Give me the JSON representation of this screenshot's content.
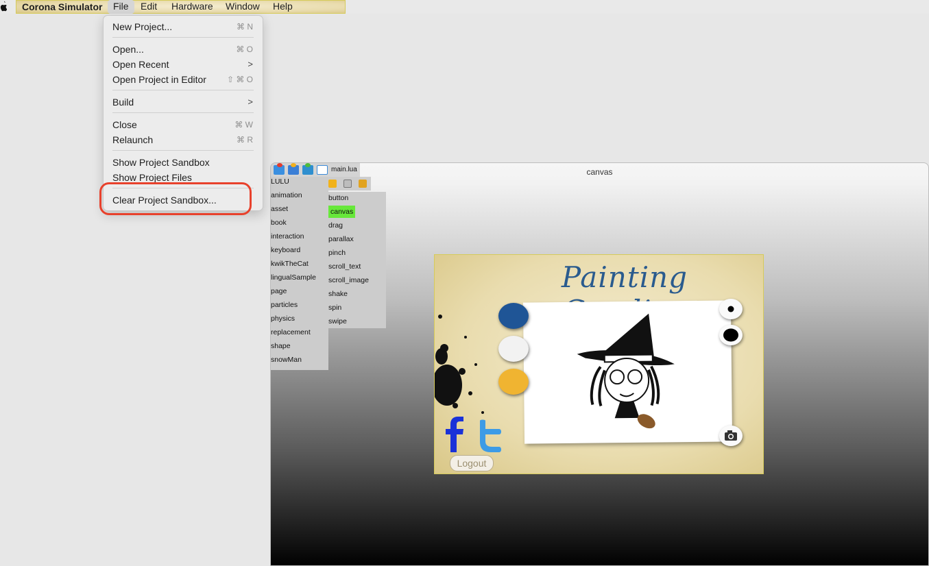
{
  "menubar": {
    "app_name": "Corona Simulator",
    "items": [
      "File",
      "Edit",
      "Hardware",
      "Window",
      "Help"
    ]
  },
  "file_menu": {
    "new_project": {
      "label": "New Project...",
      "shortcut": "⌘ N"
    },
    "open": {
      "label": "Open...",
      "shortcut": "⌘ O"
    },
    "open_recent": {
      "label": "Open Recent"
    },
    "open_in_editor": {
      "label": "Open Project in Editor",
      "shortcut": "⇧ ⌘ O"
    },
    "build": {
      "label": "Build"
    },
    "close": {
      "label": "Close",
      "shortcut": "⌘ W"
    },
    "relaunch": {
      "label": "Relaunch",
      "shortcut": "⌘ R"
    },
    "show_sandbox": {
      "label": "Show Project Sandbox"
    },
    "show_files": {
      "label": "Show Project Files"
    },
    "clear_sandbox": {
      "label": "Clear Project Sandbox..."
    }
  },
  "simulator": {
    "window_title": "canvas",
    "open_file": "main.lua",
    "projects": [
      "LULU",
      "animation",
      "asset",
      "book",
      "interaction",
      "keyboard",
      "kwikTheCat",
      "lingualSample",
      "page",
      "particles",
      "physics",
      "replacement",
      "shape",
      "snowMan"
    ],
    "pages": [
      "button",
      "canvas",
      "drag",
      "parallax",
      "pinch",
      "scroll_text",
      "scroll_image",
      "shake",
      "spin",
      "swipe"
    ],
    "selected_page": "canvas"
  },
  "app": {
    "title": "Painting Candice",
    "logout_label": "Logout",
    "swatch_colors": [
      "#1f5596",
      "#f2f2f2",
      "#f0b431"
    ],
    "social_icons": [
      "facebook-icon",
      "twitter-icon"
    ]
  }
}
